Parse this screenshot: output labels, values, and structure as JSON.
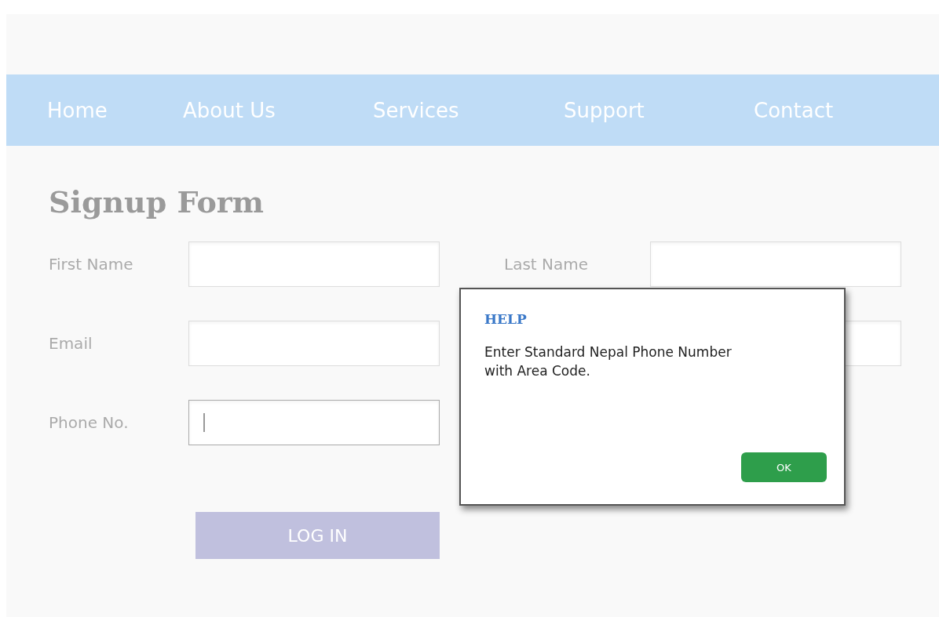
{
  "nav": {
    "items": [
      {
        "label": "Home"
      },
      {
        "label": "About Us"
      },
      {
        "label": "Services"
      },
      {
        "label": "Support"
      },
      {
        "label": "Contact"
      }
    ]
  },
  "form": {
    "title": "Signup Form",
    "rows": [
      [
        {
          "label": "First Name",
          "focused": false
        },
        {
          "label": "Last Name",
          "focused": false
        }
      ],
      [
        {
          "label": "Email",
          "focused": false
        },
        {
          "focused": false
        }
      ],
      [
        {
          "label": "Phone No.",
          "focused": true
        }
      ]
    ],
    "submit": "LOG IN"
  },
  "dialog": {
    "title": "HELP",
    "message": "Enter Standard Nepal Phone Number with Area Code.",
    "button": "OK"
  }
}
